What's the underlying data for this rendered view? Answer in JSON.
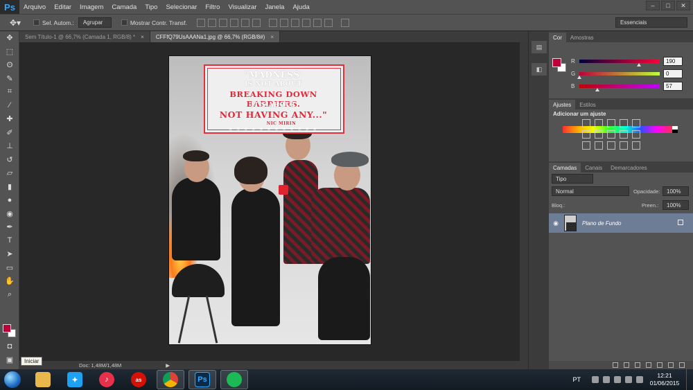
{
  "app": {
    "logo": "Ps"
  },
  "menu": [
    "Arquivo",
    "Editar",
    "Imagem",
    "Camada",
    "Tipo",
    "Selecionar",
    "Filtro",
    "Visualizar",
    "Janela",
    "Ajuda"
  ],
  "window_controls": {
    "minimize": "–",
    "maximize": "□",
    "close": "✕"
  },
  "options": {
    "auto_select_label": "Sel. Autom.:",
    "group_value": "Agrupar",
    "show_transform_label": "Mostrar Contr. Transf.",
    "workspace": "Essenciais"
  },
  "tabs": [
    {
      "label": "Sem Título-1 @ 66,7% (Camada 1, RGB/8) *",
      "close": "×"
    },
    {
      "label": "CFFfQ79UsAAANa1.jpg @ 66,7% (RGB/8#)",
      "close": "×"
    }
  ],
  "poster": {
    "line1": "\"MADNESS'",
    "line2": "IS NOT ABOUT",
    "line3": "BREAKING DOWN BARRIERS.",
    "line4": "IT'S ABOUT",
    "line5": "NOT HAVING ANY...\"",
    "line6": "NIC MIRIN",
    "stars": "★ ★ ★ ★ ★ ★ ★ ★ ★ ★ ★ ★"
  },
  "status": {
    "doc": "Doc: 1,48M/1,48M",
    "arrow": "▶",
    "tooltip": "Iniciar"
  },
  "color_panel": {
    "tabs": [
      "Cor",
      "Amostras"
    ],
    "channels": [
      {
        "label": "R",
        "value": "190",
        "fraction": 0.745
      },
      {
        "label": "G",
        "value": "0",
        "fraction": 0.0
      },
      {
        "label": "B",
        "value": "57",
        "fraction": 0.224
      }
    ],
    "foreground": "#be0039"
  },
  "adjust_panel": {
    "tabs": [
      "Ajustes",
      "Estilos"
    ],
    "title": "Adicionar um ajuste"
  },
  "layers_panel": {
    "tabs": [
      "Camadas",
      "Canais",
      "Demarcadores"
    ],
    "filter": "Tipo",
    "blend": "Normal",
    "opacity_label": "Opacidade:",
    "opacity_value": "100%",
    "lock_label": "Bloq.:",
    "fill_label": "Preen.:",
    "fill_value": "100%",
    "layer_name": "Plano de Fundo"
  },
  "taskbar": {
    "lang": "PT",
    "time": "12:21",
    "date": "01/06/2015",
    "ps_label": "Ps"
  }
}
